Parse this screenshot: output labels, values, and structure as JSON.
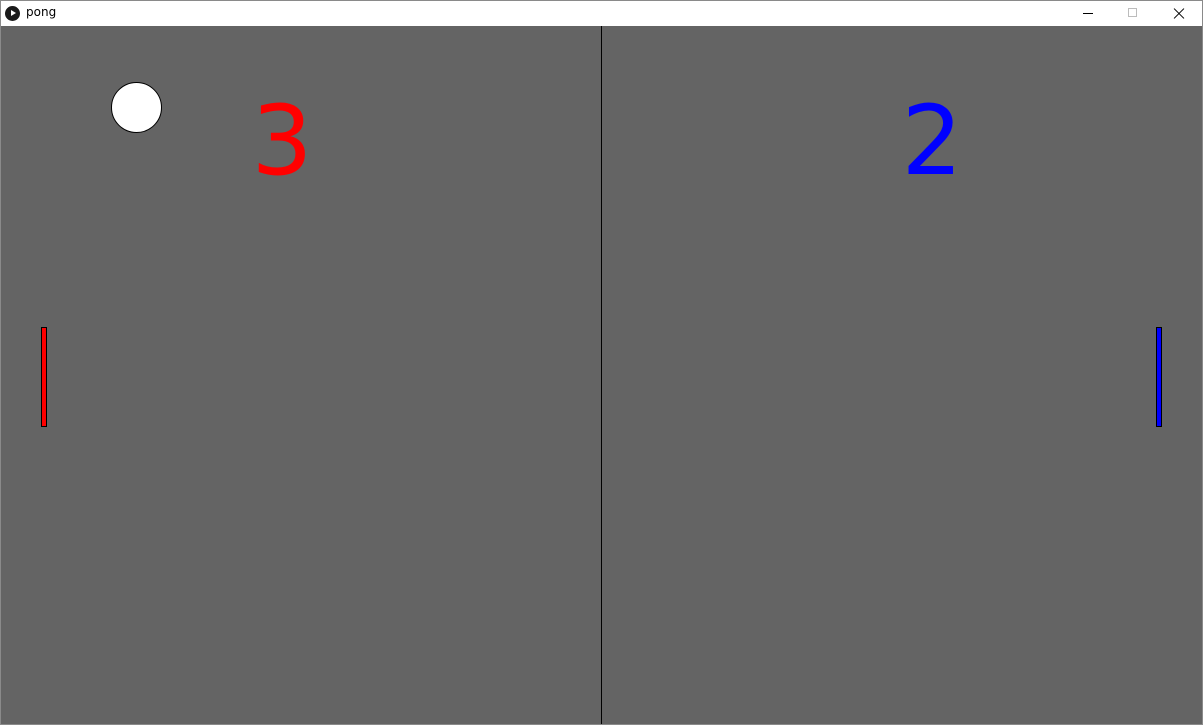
{
  "window": {
    "title": "pong",
    "app_icon": "play-circle-icon",
    "controls": {
      "minimize_icon": "minimize-icon",
      "maximize_icon": "maximize-icon",
      "close_icon": "close-icon"
    }
  },
  "game": {
    "colors": {
      "background": "#646464",
      "center_line": "#000000",
      "ball": "#ffffff",
      "left_player": "#ff0000",
      "right_player": "#0000ff"
    },
    "scores": {
      "left": "3",
      "right": "2"
    }
  }
}
